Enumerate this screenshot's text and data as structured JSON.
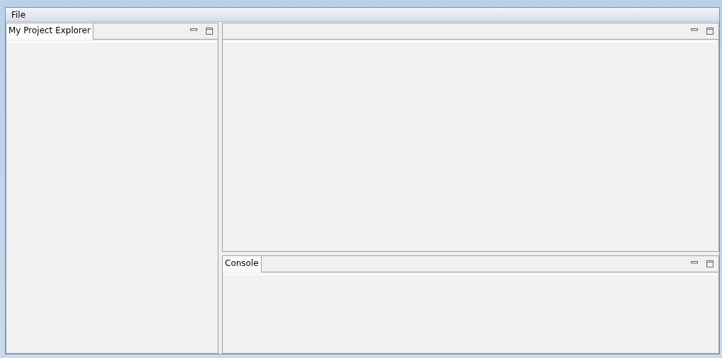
{
  "menu_bar": [
    {
      "label": "File"
    }
  ],
  "views": [
    {
      "kind": "side",
      "tab": {
        "label": "My Project Explorer",
        "selected": true
      }
    },
    {
      "kind": "editor"
    },
    {
      "kind": "bottom",
      "tab": {
        "label": "Console",
        "selected": true
      }
    }
  ]
}
